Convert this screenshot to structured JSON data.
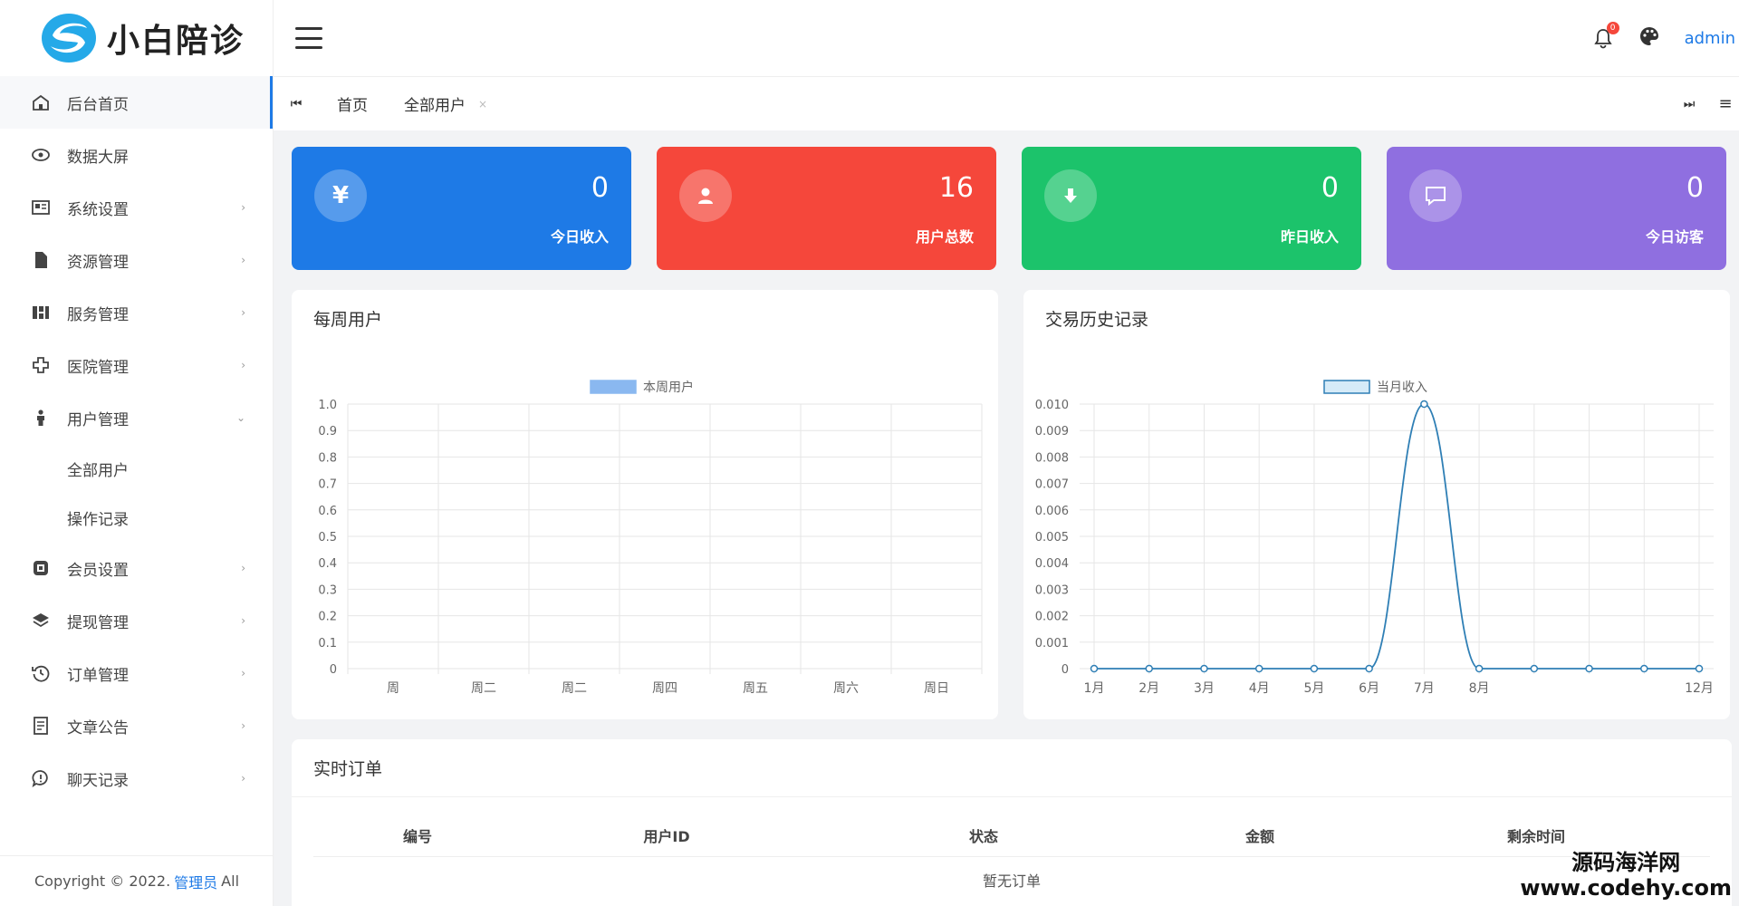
{
  "brand": {
    "name": "小白陪诊"
  },
  "sidebar": {
    "items": [
      {
        "label": "后台首页",
        "icon": "home-icon",
        "arrow": ""
      },
      {
        "label": "数据大屏",
        "icon": "eye-icon",
        "arrow": ""
      },
      {
        "label": "系统设置",
        "icon": "settings-card-icon",
        "arrow": "›"
      },
      {
        "label": "资源管理",
        "icon": "file-icon",
        "arrow": "›"
      },
      {
        "label": "服务管理",
        "icon": "grid-icon",
        "arrow": "›"
      },
      {
        "label": "医院管理",
        "icon": "cross-icon",
        "arrow": "›"
      },
      {
        "label": "用户管理",
        "icon": "person-icon",
        "arrow": "⌄"
      },
      {
        "label": "会员设置",
        "icon": "member-icon",
        "arrow": "›"
      },
      {
        "label": "提现管理",
        "icon": "layers-icon",
        "arrow": "›"
      },
      {
        "label": "订单管理",
        "icon": "history-icon",
        "arrow": "›"
      },
      {
        "label": "文章公告",
        "icon": "document-icon",
        "arrow": "›"
      },
      {
        "label": "聊天记录",
        "icon": "chat-icon",
        "arrow": "›"
      }
    ],
    "user_submenu": [
      "全部用户",
      "操作记录"
    ],
    "copyright_prefix": "Copyright © 2022.",
    "copyright_link": "管理员",
    "copyright_suffix": "All"
  },
  "header": {
    "notification_count": "0",
    "username": "admin"
  },
  "tabs": {
    "prev_glyph": "⏮",
    "next_glyph": "⏭",
    "menu_glyph": "≡",
    "items": [
      {
        "label": "首页",
        "closable": false
      },
      {
        "label": "全部用户",
        "closable": true,
        "close_glyph": "×"
      }
    ]
  },
  "stats": [
    {
      "value": "0",
      "label": "今日收入",
      "icon": "yen-icon",
      "glyph": "¥",
      "color": "#1e7ae6"
    },
    {
      "value": "16",
      "label": "用户总数",
      "icon": "user-icon",
      "glyph": "",
      "color": "#f5473b"
    },
    {
      "value": "0",
      "label": "昨日收入",
      "icon": "download-icon",
      "glyph": "",
      "color": "#1cc36b"
    },
    {
      "value": "0",
      "label": "今日访客",
      "icon": "message-icon",
      "glyph": "",
      "color": "#8f6fe0"
    }
  ],
  "chart_data": [
    {
      "type": "line",
      "title": "每周用户",
      "categories": [
        "周",
        "周二",
        "周二",
        "周四",
        "周五",
        "周六",
        "周日"
      ],
      "series": [
        {
          "name": "本周用户",
          "values": [
            0,
            0,
            0,
            0,
            0,
            0,
            0
          ]
        }
      ],
      "ylim": [
        0,
        1.0
      ],
      "yticks": [
        "0",
        "0.1",
        "0.2",
        "0.3",
        "0.4",
        "0.5",
        "0.6",
        "0.7",
        "0.8",
        "0.9",
        "1.0"
      ],
      "legend": "top-center",
      "grid": true,
      "color": "#8ab8f0"
    },
    {
      "type": "line",
      "title": "交易历史记录",
      "categories": [
        "1月",
        "2月",
        "3月",
        "4月",
        "5月",
        "6月",
        "7月",
        "8月",
        "",
        "",
        "",
        "12月"
      ],
      "series": [
        {
          "name": "当月收入",
          "values": [
            0,
            0,
            0,
            0,
            0,
            0,
            0.01,
            0,
            0,
            0,
            0,
            0
          ]
        }
      ],
      "ylim": [
        0,
        0.01
      ],
      "yticks": [
        "0",
        "0.001",
        "0.002",
        "0.003",
        "0.004",
        "0.005",
        "0.006",
        "0.007",
        "0.008",
        "0.009",
        "0.010"
      ],
      "legend": "top-center",
      "grid": true,
      "color": "#2f7fb5"
    }
  ],
  "orders": {
    "title": "实时订单",
    "columns": [
      "编号",
      "用户ID",
      "状态",
      "金额",
      "剩余时间"
    ],
    "empty_text": "暂无订单"
  },
  "watermark": {
    "line1": "源码海洋网",
    "line2": "www.codehy.com"
  }
}
